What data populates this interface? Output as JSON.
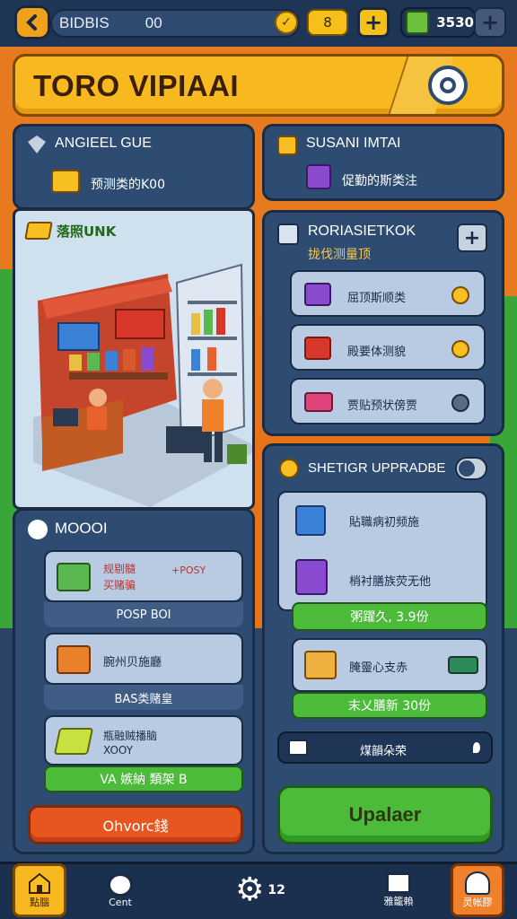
{
  "top_bar": {
    "title": "BIDBIS",
    "title_value": "00",
    "resource_value": "8",
    "cash_value": "3530"
  },
  "banner": {
    "title": "TORO VIPIAAI"
  },
  "panels": {
    "left_top": {
      "title": "ANGIEEL GUE",
      "reward": "预测类的K00"
    },
    "right_top": {
      "title": "SUSANI IMTAI",
      "subtitle": "促勤的斯类注"
    },
    "store": {
      "label": "落照UNK"
    },
    "right_mid": {
      "title": "RORIASIETKOK",
      "subtitle": "拢伐测量顶",
      "items": [
        {
          "label": "屈顶斯顺类"
        },
        {
          "label": "殿要体测貌"
        },
        {
          "label": "贾贴预状傍贾"
        }
      ]
    },
    "left_bottom": {
      "title": "MOOOI",
      "items": [
        {
          "line1": "规剔髓",
          "line2": "买赌骗",
          "price": "+POSY",
          "bar": "POSP BOI"
        },
        {
          "line1": "腕州贝施廳",
          "bar": "BAS类赌皇"
        },
        {
          "line1": "瓶融贼播脑",
          "line2": "XOOY",
          "bar": "VA 嫉納 類架 B"
        }
      ],
      "action_button": "Ohvorc錢"
    },
    "right_bottom": {
      "title": "SHETIGR UPPRADBE",
      "items": [
        {
          "label": "貼職病初频施"
        },
        {
          "label": "梢衬膳族荧无他"
        }
      ],
      "green_bar_1": "粥躍久, 3.9份",
      "item3": "腌靈心支赤",
      "green_bar_2": "末乂膳新 30份",
      "info_row": "煤韻朵荣",
      "upgrade_button": "Upalaer"
    }
  },
  "bottom_nav": {
    "items": [
      {
        "label": "點腦"
      },
      {
        "label": "Cent"
      },
      {
        "label": "12"
      },
      {
        "label": "雅籠賴"
      },
      {
        "label": "灵帐膠"
      }
    ]
  },
  "colors": {
    "gold": "#f7b820",
    "navy": "#1f3556",
    "panel": "#2e4c72",
    "green": "#4cbb3a",
    "orange": "#e77a1e",
    "red_button": "#e7561f"
  }
}
